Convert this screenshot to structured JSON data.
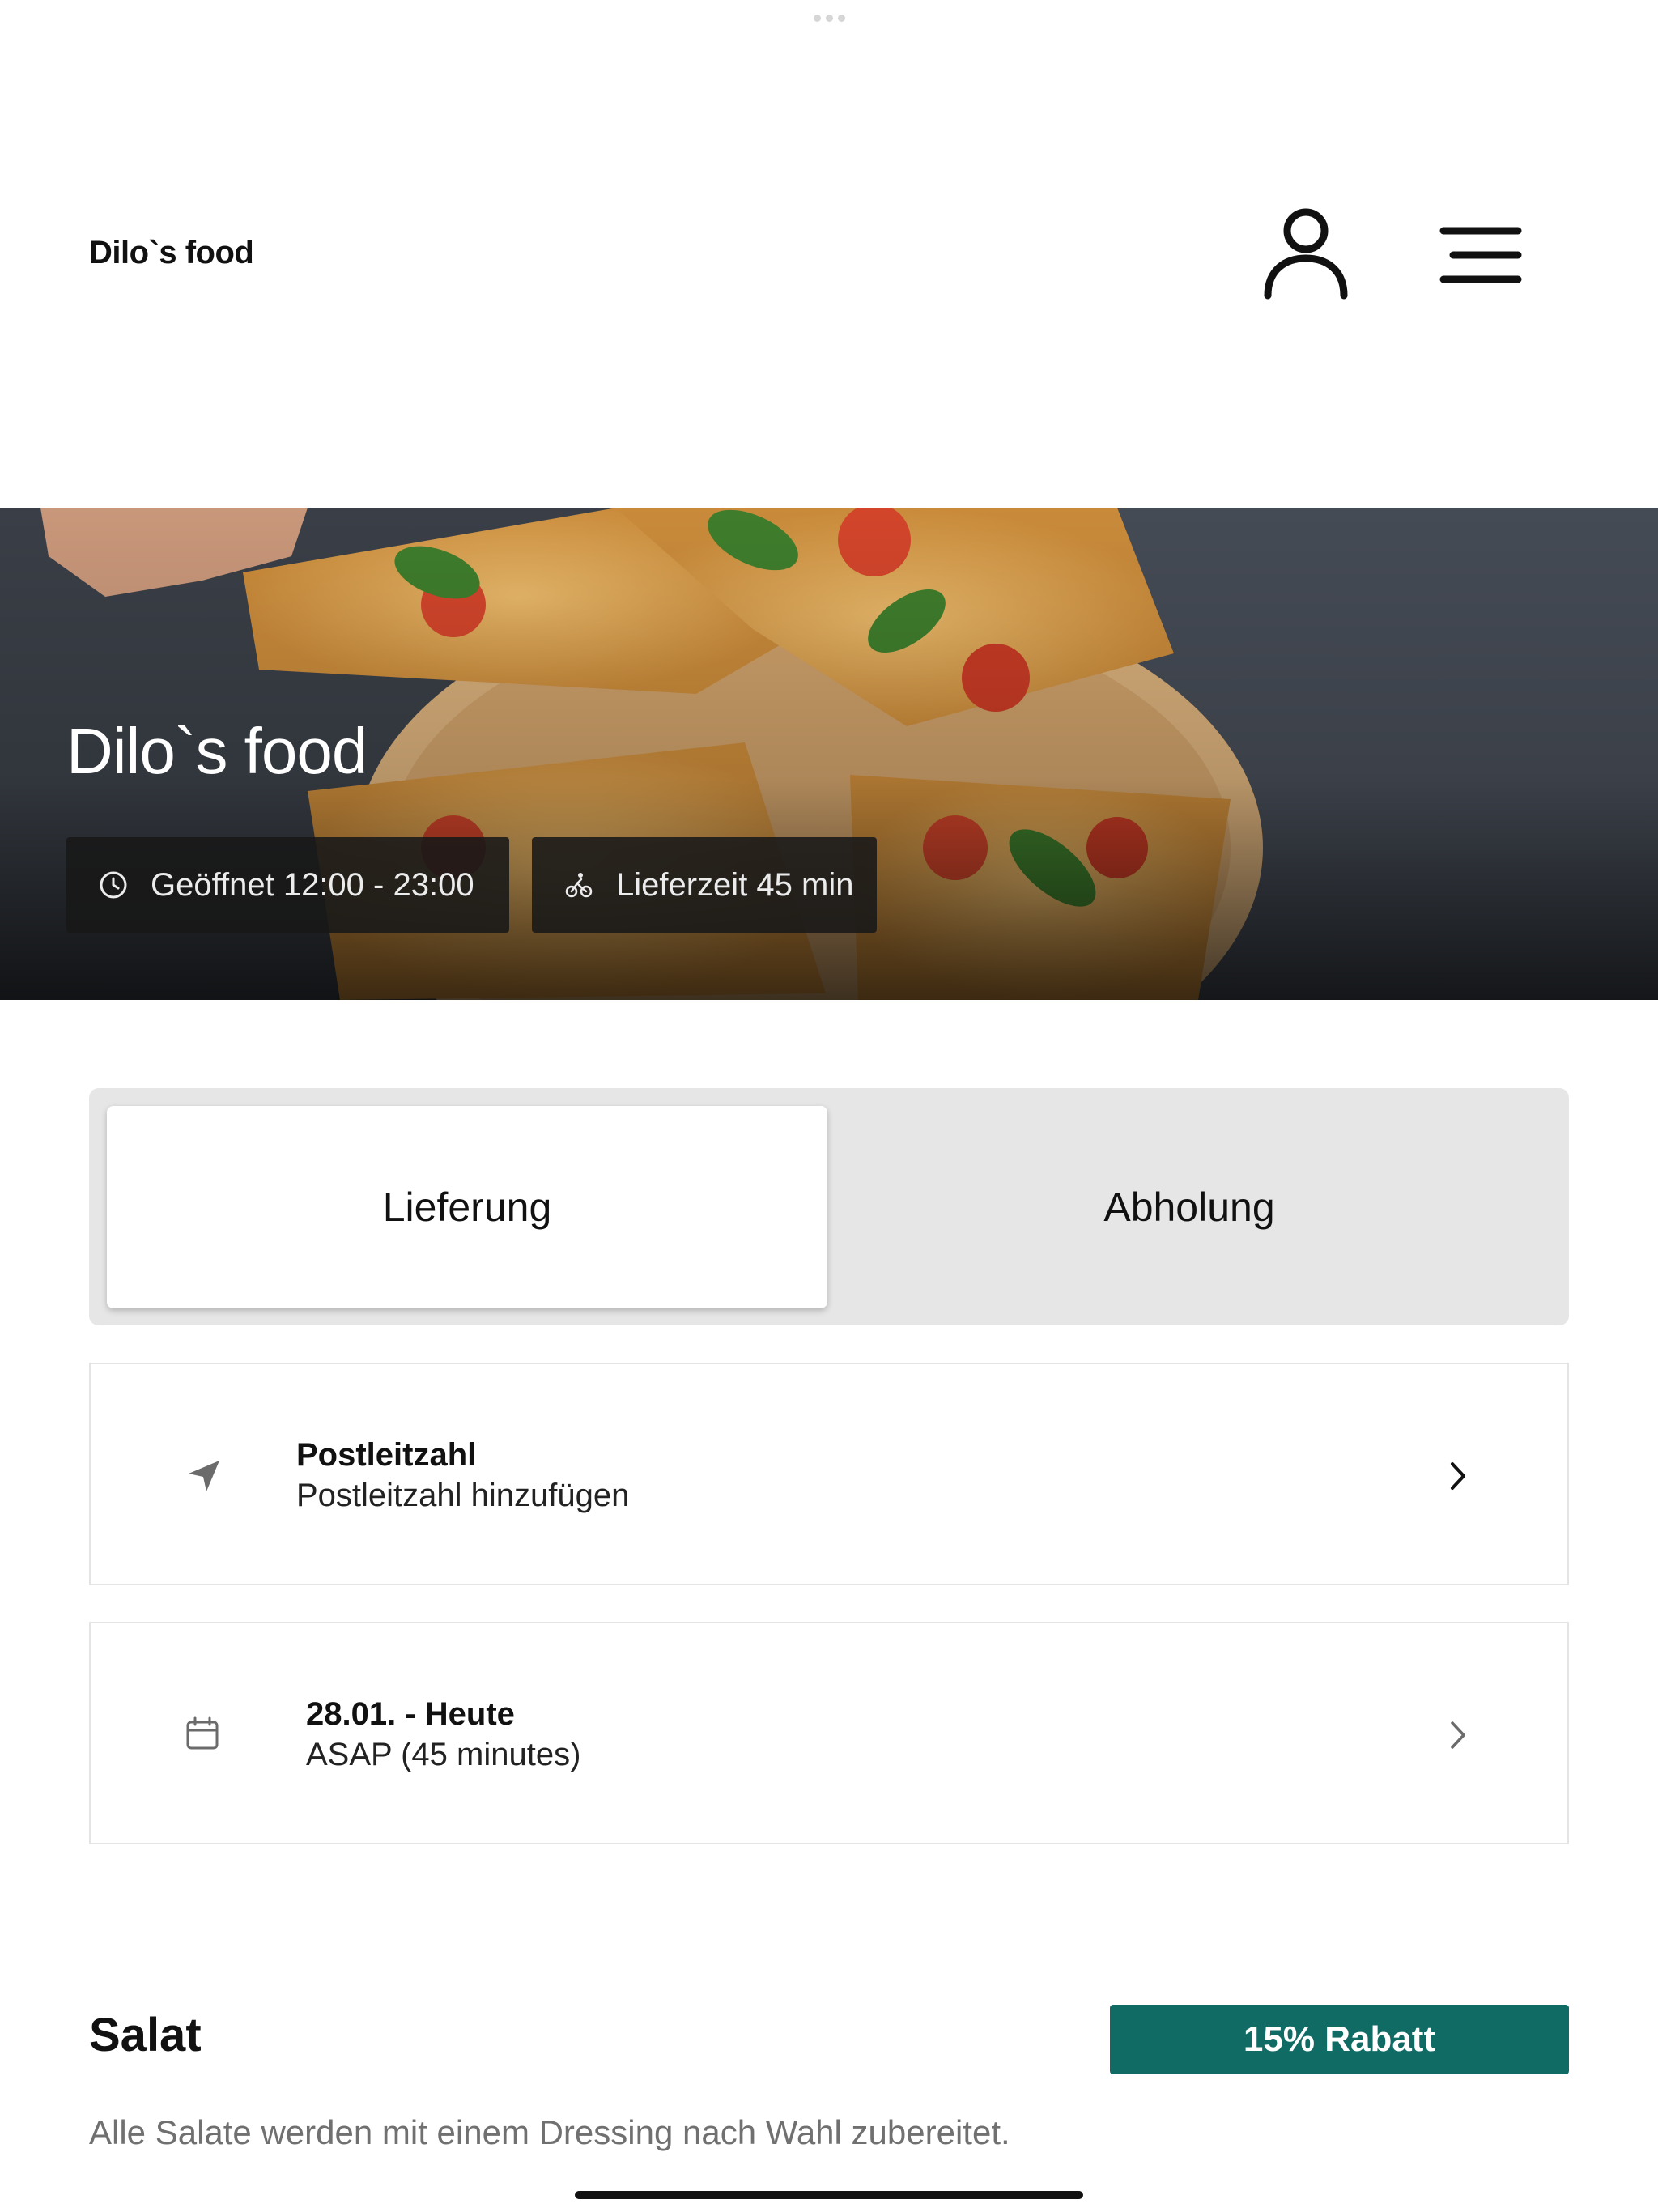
{
  "header": {
    "brand": "Dilo`s food",
    "user_icon": "user-icon",
    "menu_icon": "hamburger-menu-icon"
  },
  "hero": {
    "title": "Dilo`s food",
    "opening_hours": "Geöffnet 12:00 - 23:00",
    "opening_icon": "clock-icon",
    "delivery_time": "Lieferzeit 45 min",
    "delivery_icon": "bicycle-icon"
  },
  "order_mode": {
    "options": [
      "Lieferung",
      "Abholung"
    ],
    "selected": "Lieferung"
  },
  "postcode_card": {
    "icon": "location-arrow-icon",
    "title": "Postleitzahl",
    "subtitle": "Postleitzahl hinzufügen"
  },
  "date_card": {
    "icon": "calendar-icon",
    "title": "28.01. - Heute",
    "subtitle": "ASAP (45 minutes)"
  },
  "section": {
    "title": "Salat",
    "badge": "15% Rabatt",
    "description": "Alle Salate werden mit einem Dressing nach Wahl zubereitet."
  },
  "colors": {
    "accent": "#0f6b63",
    "segment_bg": "#e6e6e6"
  }
}
